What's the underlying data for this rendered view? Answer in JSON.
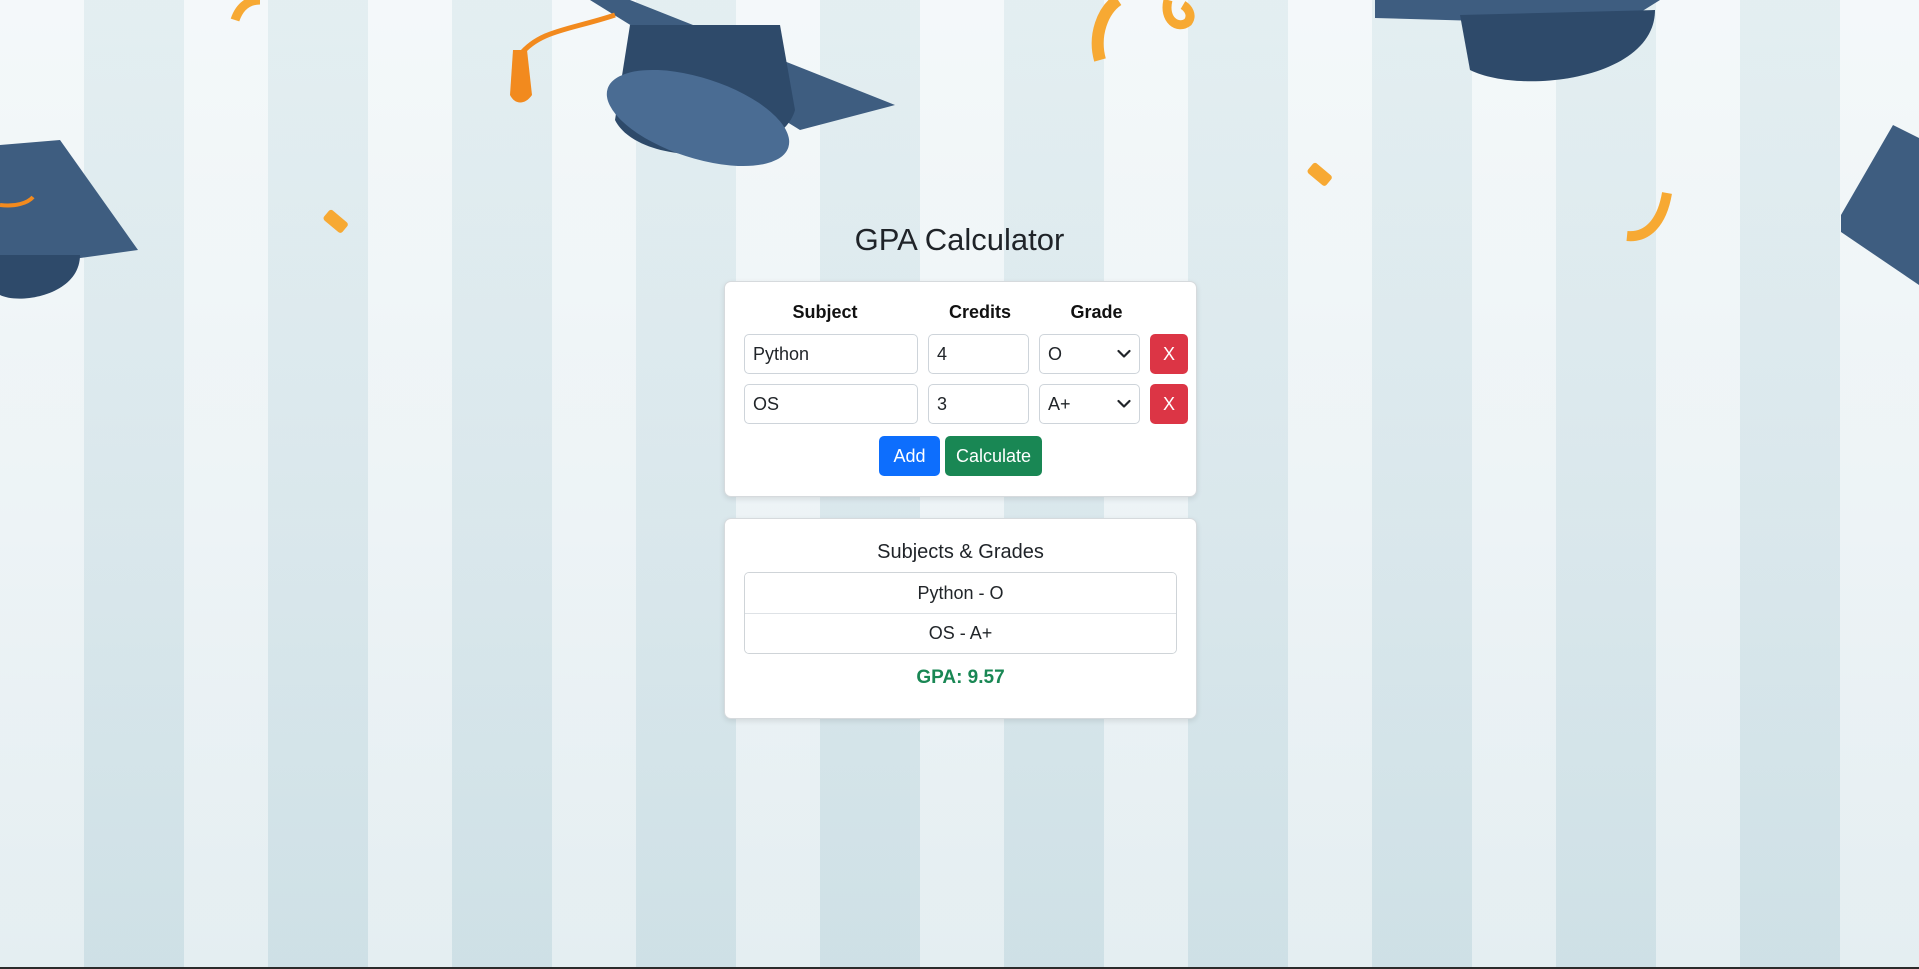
{
  "app": {
    "title": "GPA Calculator"
  },
  "form": {
    "headers": {
      "subject": "Subject",
      "credits": "Credits",
      "grade": "Grade"
    },
    "rows": [
      {
        "subject": "Python",
        "credits": "4",
        "grade": "O",
        "remove_label": "X"
      },
      {
        "subject": "OS",
        "credits": "3",
        "grade": "A+",
        "remove_label": "X"
      }
    ],
    "add_label": "Add",
    "calculate_label": "Calculate"
  },
  "results": {
    "title": "Subjects & Grades",
    "items": [
      "Python - O",
      "OS - A+"
    ],
    "gpa_text": "GPA: 9.57"
  },
  "colors": {
    "primary": "#0d6efd",
    "success": "#198754",
    "danger": "#dc3545",
    "cap": "#3e5d80",
    "confetti": "#f7a933"
  }
}
